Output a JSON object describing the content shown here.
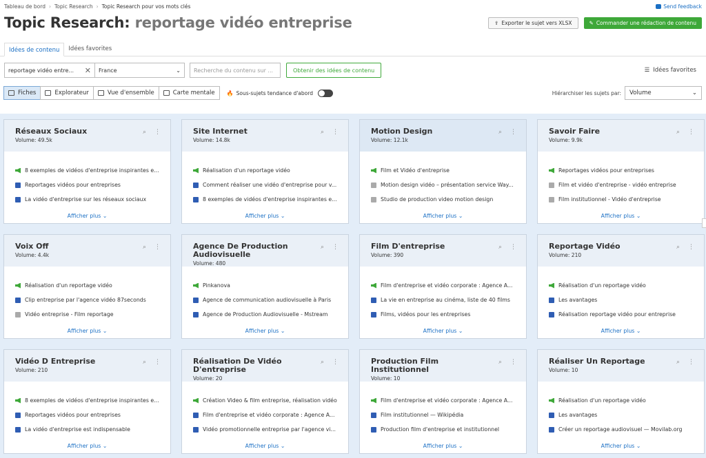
{
  "breadcrumb": [
    "Tableau de bord",
    "Topic Research",
    "Topic Research pour vos mots clés"
  ],
  "feedback_label": "Send feedback",
  "title_main": "Topic Research:",
  "title_sub": "reportage vidéo entreprise",
  "export_label": "Exporter le sujet vers XLSX",
  "order_label": "Commander une rédaction de contenu",
  "tabs": [
    "Idées de contenu",
    "Idées favorites"
  ],
  "keyword_value": "reportage vidéo entre...",
  "country_value": "France",
  "search_placeholder": "Recherche du contenu sur ...",
  "get_ideas_label": "Obtenir des idées de contenu",
  "favorites_link": "Idées favorites",
  "views": [
    "Fiches",
    "Explorateur",
    "Vue d'ensemble",
    "Carte mentale"
  ],
  "trend_label": "Sous-sujets tendance d'abord",
  "sort_label": "Hiérarchiser les sujets par:",
  "sort_value": "Volume",
  "colors": {
    "accent": "#1a6fc4",
    "green": "#3ea839",
    "grid_bg": "#e3edf8"
  },
  "cards": [
    {
      "title": "Réseaux Sociaux",
      "volume": "Volume: 49.5k",
      "items": [
        {
          "icon": "megaphone-icon",
          "text": "8 exemples de vidéos d'entreprise inspirantes e..."
        },
        {
          "icon": "document-icon",
          "text": "Reportages vidéos pour entreprises"
        },
        {
          "icon": "document-icon",
          "text": "La vidéo d'entreprise sur les réseaux sociaux"
        }
      ],
      "more": "Afficher plus"
    },
    {
      "title": "Site Internet",
      "volume": "Volume: 14.8k",
      "items": [
        {
          "icon": "megaphone-icon",
          "text": "Réalisation d'un reportage vidéo"
        },
        {
          "icon": "document-icon",
          "text": "Comment réaliser une vidéo d'entreprise pour v..."
        },
        {
          "icon": "document-icon",
          "text": "8 exemples de vidéos d'entreprise inspirantes e..."
        }
      ],
      "more": "Afficher plus"
    },
    {
      "title": "Motion Design",
      "volume": "Volume: 12.1k",
      "items": [
        {
          "icon": "megaphone-icon",
          "text": "Film et Vidéo d'entreprise"
        },
        {
          "icon": "question-icon",
          "text": "Motion design vidéo – présentation service Way..."
        },
        {
          "icon": "question-icon",
          "text": "Studio de production video motion design"
        }
      ],
      "more": "Afficher plus"
    },
    {
      "title": "Savoir Faire",
      "volume": "Volume: 9.9k",
      "items": [
        {
          "icon": "megaphone-icon",
          "text": "Reportages vidéos pour entreprises"
        },
        {
          "icon": "question-icon",
          "text": "Film et vidéo d'entreprise - vidéo entreprise"
        },
        {
          "icon": "question-icon",
          "text": "Film institutionnel - Vidéo d'entreprise"
        }
      ],
      "more": "Afficher plus"
    },
    {
      "title": "Voix Off",
      "volume": "Volume: 4.4k",
      "items": [
        {
          "icon": "megaphone-icon",
          "text": "Réalisation d'un reportage vidéo"
        },
        {
          "icon": "document-icon",
          "text": "Clip entreprise par l'agence vidéo 87seconds"
        },
        {
          "icon": "question-icon",
          "text": "Vidéo entreprise - Film reportage"
        }
      ],
      "more": "Afficher plus"
    },
    {
      "title": "Agence De Production Audiovisuelle",
      "volume": "Volume: 480",
      "items": [
        {
          "icon": "megaphone-icon",
          "text": "Pinkanova"
        },
        {
          "icon": "document-icon",
          "text": "Agence de communication audiovisuelle à Paris"
        },
        {
          "icon": "document-icon",
          "text": "Agence de Production Audiovisuelle - Mstream"
        }
      ],
      "more": "Afficher plus"
    },
    {
      "title": "Film D'entreprise",
      "volume": "Volume: 390",
      "items": [
        {
          "icon": "megaphone-icon",
          "text": "Film d'entreprise et vidéo corporate : Agence A..."
        },
        {
          "icon": "document-icon",
          "text": "La vie en entreprise au cinéma, liste de 40 films"
        },
        {
          "icon": "document-icon",
          "text": "Films, vidéos pour les entreprises"
        }
      ],
      "more": "Afficher plus"
    },
    {
      "title": "Reportage Vidéo",
      "volume": "Volume: 210",
      "items": [
        {
          "icon": "megaphone-icon",
          "text": "Réalisation d'un reportage vidéo"
        },
        {
          "icon": "document-icon",
          "text": "Les avantages"
        },
        {
          "icon": "document-icon",
          "text": "Réalisation reportage vidéo pour entreprise"
        }
      ],
      "more": "Afficher plus"
    },
    {
      "title": "Vidéo D Entreprise",
      "volume": "Volume: 210",
      "items": [
        {
          "icon": "megaphone-icon",
          "text": "8 exemples de vidéos d'entreprise inspirantes e..."
        },
        {
          "icon": "document-icon",
          "text": "Reportages vidéos pour entreprises"
        },
        {
          "icon": "document-icon",
          "text": "La vidéo d'entreprise est indispensable"
        }
      ],
      "more": "Afficher plus"
    },
    {
      "title": "Réalisation De Vidéo D'entreprise",
      "volume": "Volume: 20",
      "items": [
        {
          "icon": "megaphone-icon",
          "text": "Création Video & film entreprise, réalisation vidéo"
        },
        {
          "icon": "document-icon",
          "text": "Film d'entreprise et vidéo corporate : Agence A..."
        },
        {
          "icon": "document-icon",
          "text": "Vidéo promotionnelle entreprise par l'agence vi..."
        }
      ],
      "more": "Afficher plus"
    },
    {
      "title": "Production Film Institutionnel",
      "volume": "Volume: 10",
      "items": [
        {
          "icon": "megaphone-icon",
          "text": "Film d'entreprise et vidéo corporate : Agence A..."
        },
        {
          "icon": "document-icon",
          "text": "Film institutionnel — Wikipédia"
        },
        {
          "icon": "document-icon",
          "text": "Production film d'entreprise et institutionnel"
        }
      ],
      "more": "Afficher plus"
    },
    {
      "title": "Réaliser Un Reportage",
      "volume": "Volume: 10",
      "items": [
        {
          "icon": "megaphone-icon",
          "text": "Réalisation d'un reportage vidéo"
        },
        {
          "icon": "document-icon",
          "text": "Les avantages"
        },
        {
          "icon": "document-icon",
          "text": "Créer un reportage audiovisuel — Movilab.org"
        }
      ],
      "more": "Afficher plus"
    }
  ]
}
